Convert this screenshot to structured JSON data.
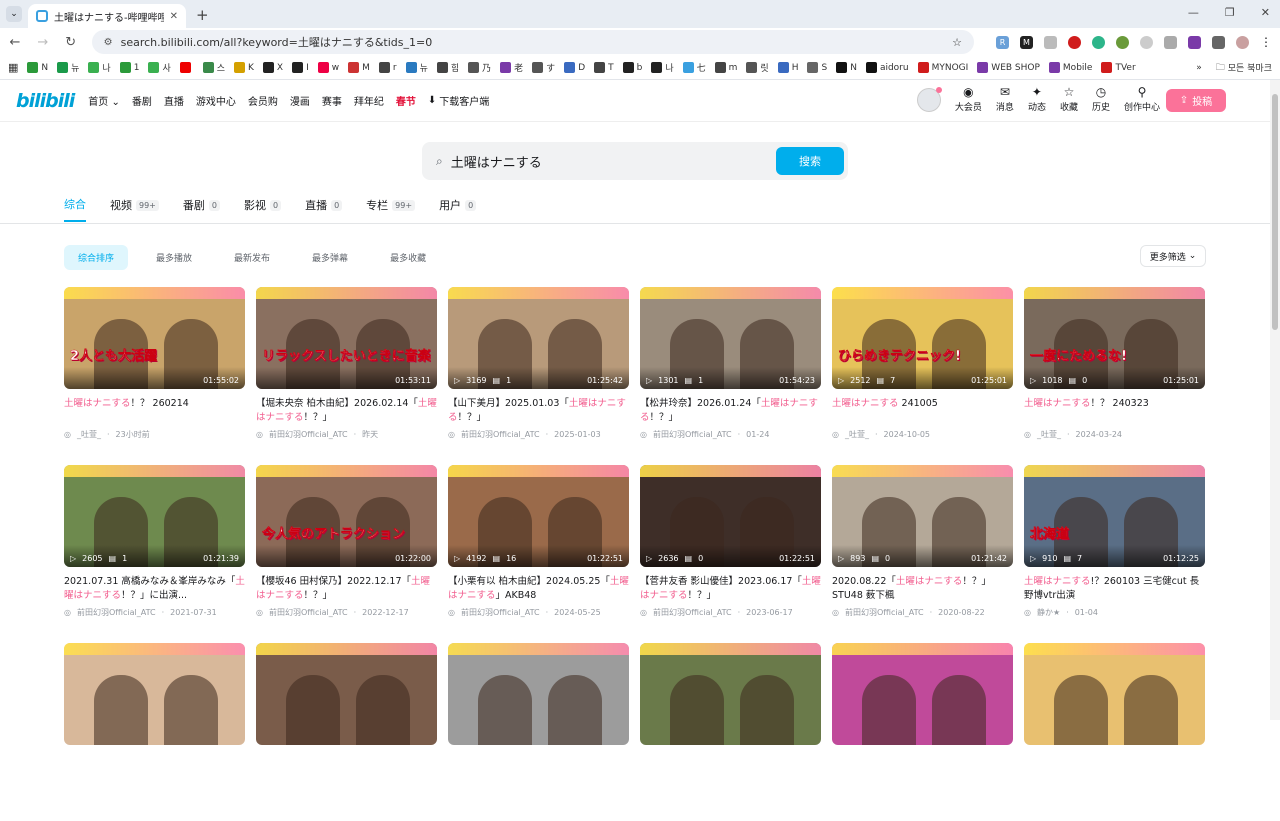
{
  "browser": {
    "tab_title": "土曜はナニする-哔哩哔哩_bilil...",
    "url": "search.bilibili.com/all?keyword=土曜はナニする&tids_1=0",
    "bookmarks": [
      "N",
      "뉴",
      "나",
      "1",
      "사",
      "",
      "스",
      "K",
      "X",
      "I",
      "w",
      "M",
      "r",
      "뉴",
      "힘",
      "乃",
      "老",
      "す",
      "D",
      "T",
      "b",
      "나",
      "七",
      "m",
      "릿",
      "H",
      "S",
      "N",
      "aidoru",
      "MYNOGI",
      "WEB SHOP",
      "Mobile",
      "TVer"
    ],
    "bookmarks_folder": "모든 북마크"
  },
  "header": {
    "logo": "bilibili",
    "nav": [
      "首页",
      "番剧",
      "直播",
      "游戏中心",
      "会员购",
      "漫画",
      "赛事",
      "拜年纪"
    ],
    "spring": "春节",
    "download": "下载客户端",
    "right_items": [
      "大会员",
      "消息",
      "动态",
      "收藏",
      "历史",
      "创作中心"
    ],
    "upload_label": "投稿"
  },
  "search": {
    "query": "土曜はナニする",
    "button": "搜索"
  },
  "tabs": [
    {
      "label": "综合",
      "count": ""
    },
    {
      "label": "视频",
      "count": "99+"
    },
    {
      "label": "番剧",
      "count": "0"
    },
    {
      "label": "影视",
      "count": "0"
    },
    {
      "label": "直播",
      "count": "0"
    },
    {
      "label": "专栏",
      "count": "99+"
    },
    {
      "label": "用户",
      "count": "0"
    }
  ],
  "sorts": [
    "综合排序",
    "最多播放",
    "最新发布",
    "最多弹幕",
    "最多收藏"
  ],
  "more_filter": "更多筛选",
  "videos": [
    {
      "pre": "",
      "hl": "土曜はナニする",
      "post": "！？ 260214",
      "views": "",
      "danmaku": "",
      "duration": "01:55:02",
      "uploader": "_吐萱_",
      "date": "23小时前",
      "bg": "#c9a46a",
      "caption": "2人とも大活躍"
    },
    {
      "pre": "【堀未央奈 柏木由紀】2026.02.14「",
      "hl": "土曜はナニする",
      "post": "！？」",
      "views": "",
      "danmaku": "",
      "duration": "01:53:11",
      "uploader": "前田幻羽Official_ATC",
      "date": "昨天",
      "bg": "#8a7060",
      "caption": "リラックスしたいときに音楽聴いたり"
    },
    {
      "pre": "【山下美月】2025.01.03「",
      "hl": "土曜はナニする",
      "post": "！？」",
      "views": "3169",
      "danmaku": "1",
      "duration": "01:25:42",
      "uploader": "前田幻羽Official_ATC",
      "date": "2025-01-03",
      "bg": "#b89a7a",
      "caption": ""
    },
    {
      "pre": "【松井玲奈】2026.01.24「",
      "hl": "土曜はナニする",
      "post": "！？」",
      "views": "1301",
      "danmaku": "1",
      "duration": "01:54:23",
      "uploader": "前田幻羽Official_ATC",
      "date": "01-24",
      "bg": "#9a8c7c",
      "caption": ""
    },
    {
      "pre": "",
      "hl": "土曜はナニする",
      "post": " 241005",
      "views": "2512",
      "danmaku": "7",
      "duration": "01:25:01",
      "uploader": "_吐萱_",
      "date": "2024-10-05",
      "bg": "#e6c25a",
      "caption": "ひらめきテクニック!"
    },
    {
      "pre": "",
      "hl": "土曜はナニする",
      "post": "！？ 240323",
      "views": "1018",
      "danmaku": "0",
      "duration": "01:25:01",
      "uploader": "_吐萱_",
      "date": "2024-03-24",
      "bg": "#7a6a5c",
      "caption": "一度にためるな!"
    },
    {
      "pre": "2021.07.31 高橋みなみ＆峯岸みなみ「",
      "hl": "土曜はナニする",
      "post": "！？」に出演...",
      "views": "2605",
      "danmaku": "1",
      "duration": "01:21:39",
      "uploader": "前田幻羽Official_ATC",
      "date": "2021-07-31",
      "bg": "#6e8a4e",
      "caption": ""
    },
    {
      "pre": "【櫻坂46 田村保乃】2022.12.17「",
      "hl": "土曜はナニする",
      "post": "！？」",
      "views": "",
      "danmaku": "",
      "duration": "01:22:00",
      "uploader": "前田幻羽Official_ATC",
      "date": "2022-12-17",
      "bg": "#8c6a58",
      "caption": "今人気のアトラクション"
    },
    {
      "pre": "【小栗有以 柏木由紀】2024.05.25「",
      "hl": "土曜はナニする",
      "post": "」AKB48",
      "views": "4192",
      "danmaku": "16",
      "duration": "01:22:51",
      "uploader": "前田幻羽Official_ATC",
      "date": "2024-05-25",
      "bg": "#9a6a4a",
      "caption": ""
    },
    {
      "pre": "【菅井友香 影山優佳】2023.06.17「",
      "hl": "土曜はナニする",
      "post": "！？」",
      "views": "2636",
      "danmaku": "0",
      "duration": "01:22:51",
      "uploader": "前田幻羽Official_ATC",
      "date": "2023-06-17",
      "bg": "#3e2e28",
      "caption": ""
    },
    {
      "pre": "2020.08.22「",
      "hl": "土曜はナニする",
      "post": "！？」STU48 薮下楓",
      "views": "893",
      "danmaku": "0",
      "duration": "01:21:42",
      "uploader": "前田幻羽Official_ATC",
      "date": "2020-08-22",
      "bg": "#b4a898",
      "caption": ""
    },
    {
      "pre": "",
      "hl": "土曜はナニする",
      "post": "!？260103 三宅健cut 長野博vtr出演",
      "views": "910",
      "danmaku": "7",
      "duration": "01:12:25",
      "uploader": "静か★",
      "date": "01-04",
      "bg": "#5a6e86",
      "caption": "北海道"
    },
    {
      "pre": "",
      "hl": "",
      "post": "",
      "views": "",
      "danmaku": "",
      "duration": "",
      "uploader": "",
      "date": "",
      "bg": "#d8b89a",
      "caption": ""
    },
    {
      "pre": "",
      "hl": "",
      "post": "",
      "views": "",
      "danmaku": "",
      "duration": "",
      "uploader": "",
      "date": "",
      "bg": "#7a5c4a",
      "caption": ""
    },
    {
      "pre": "",
      "hl": "",
      "post": "",
      "views": "",
      "danmaku": "",
      "duration": "",
      "uploader": "",
      "date": "",
      "bg": "#9c9c9c",
      "caption": ""
    },
    {
      "pre": "",
      "hl": "",
      "post": "",
      "views": "",
      "danmaku": "",
      "duration": "",
      "uploader": "",
      "date": "",
      "bg": "#6a7a4a",
      "caption": ""
    },
    {
      "pre": "",
      "hl": "",
      "post": "",
      "views": "",
      "danmaku": "",
      "duration": "",
      "uploader": "",
      "date": "",
      "bg": "#c04a9a",
      "caption": ""
    },
    {
      "pre": "",
      "hl": "",
      "post": "",
      "views": "",
      "danmaku": "",
      "duration": "",
      "uploader": "",
      "date": "",
      "bg": "#e8c070",
      "caption": ""
    }
  ]
}
